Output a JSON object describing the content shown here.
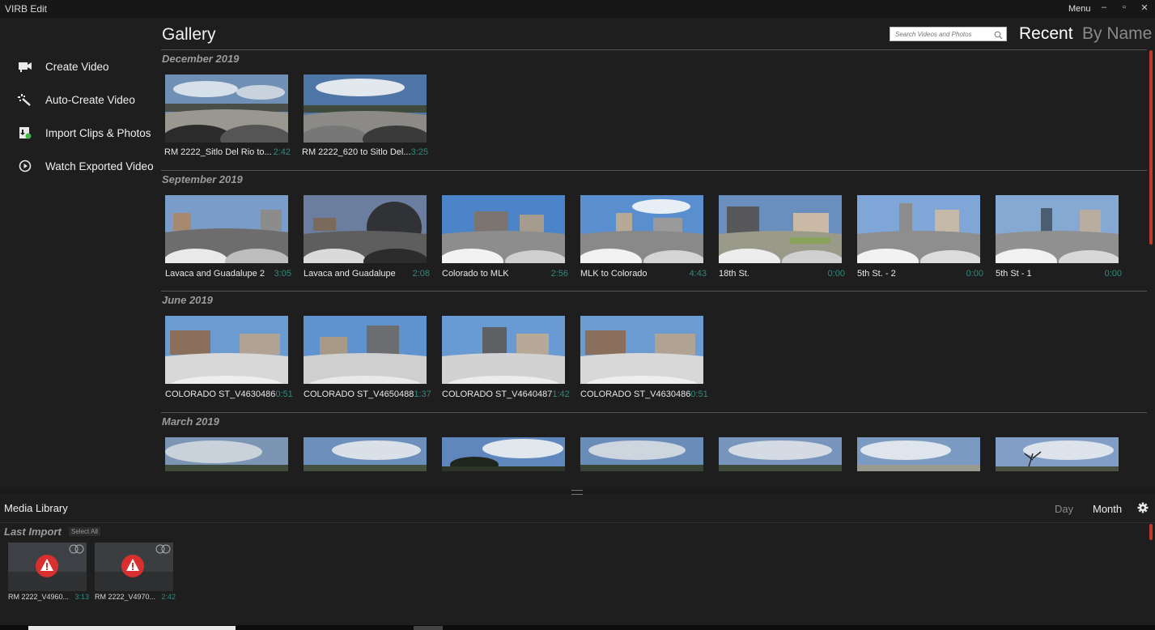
{
  "app": {
    "title": "VIRB Edit",
    "menu_label": "Menu",
    "minimize": "–",
    "restore": "▫",
    "close": "✕"
  },
  "sidebar": {
    "items": [
      {
        "label": "Create Video",
        "icon": "camera-icon"
      },
      {
        "label": "Auto-Create Video",
        "icon": "magic-wand-icon"
      },
      {
        "label": "Import Clips & Photos",
        "icon": "import-icon"
      },
      {
        "label": "Watch Exported Video",
        "icon": "play-circle-icon"
      }
    ]
  },
  "gallery": {
    "title": "Gallery",
    "search_placeholder": "Search Videos and Photos",
    "sort_recent": "Recent",
    "sort_by_name": "By Name",
    "sections": [
      {
        "month": "December 2019",
        "items": [
          {
            "name": "RM 2222_Sitlo Del Rio to...",
            "duration": "2:42"
          },
          {
            "name": "RM 2222_620 to Sitlo Del...",
            "duration": "3:25"
          }
        ]
      },
      {
        "month": "September 2019",
        "items": [
          {
            "name": "Lavaca and Guadalupe 2",
            "duration": "3:05"
          },
          {
            "name": "Lavaca and Guadalupe",
            "duration": "2:08"
          },
          {
            "name": "Colorado to MLK",
            "duration": "2:56"
          },
          {
            "name": "MLK to Colorado",
            "duration": "4:43"
          },
          {
            "name": "18th St.",
            "duration": "0:00"
          },
          {
            "name": "5th St. - 2",
            "duration": "0:00"
          },
          {
            "name": "5th St - 1",
            "duration": "0:00"
          }
        ]
      },
      {
        "month": "June 2019",
        "items": [
          {
            "name": "COLORADO ST_V4630486",
            "duration": "0:51"
          },
          {
            "name": "COLORADO ST_V4650488",
            "duration": "1:37"
          },
          {
            "name": "COLORADO ST_V4640487",
            "duration": "1:42"
          },
          {
            "name": "COLORADO ST_V4630486",
            "duration": "0:51"
          }
        ]
      },
      {
        "month": "March 2019",
        "items": [
          {
            "name": "",
            "duration": ""
          },
          {
            "name": "",
            "duration": ""
          },
          {
            "name": "",
            "duration": ""
          },
          {
            "name": "",
            "duration": ""
          },
          {
            "name": "",
            "duration": ""
          },
          {
            "name": "",
            "duration": ""
          },
          {
            "name": "",
            "duration": ""
          }
        ]
      }
    ]
  },
  "media_library": {
    "title": "Media Library",
    "view_day": "Day",
    "view_month": "Month",
    "group_label": "Last Import",
    "select_all": "Select All",
    "items": [
      {
        "name": "RM 2222_V4960...",
        "duration": "3:13"
      },
      {
        "name": "RM 2222_V4970...",
        "duration": "2:42"
      }
    ]
  },
  "colors": {
    "background": "#1e1e1e",
    "accent": "#c0392b",
    "duration_text": "#2f8a7e",
    "warning": "#d9302f"
  }
}
